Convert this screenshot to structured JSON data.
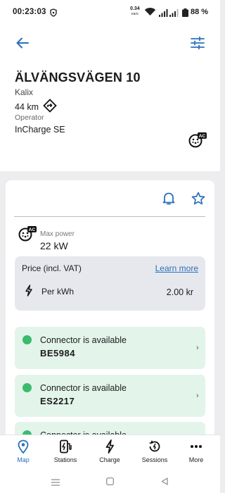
{
  "status_bar": {
    "time": "00:23:03",
    "net_speed": "0.34",
    "net_speed_unit": "KB/S",
    "battery_pct": "88 %"
  },
  "header": {
    "back_icon": "arrow-left-icon",
    "filter_icon": "sliders-icon"
  },
  "station": {
    "name": "ÄLVÄNGSVÄGEN 10",
    "city": "Kalix",
    "distance": "44 km",
    "operator_label": "Operator",
    "operator": "InCharge SE",
    "plug_badge": "AC"
  },
  "details": {
    "max_power_label": "Max power",
    "max_power_value": "22 kW",
    "plug_badge": "AC",
    "price": {
      "title": "Price (incl. VAT)",
      "learn_more": "Learn more",
      "per_kwh_label": "Per kWh",
      "per_kwh_value": "2.00 kr"
    }
  },
  "connectors": [
    {
      "status": "Connector is available",
      "id": "BE5984"
    },
    {
      "status": "Connector is available",
      "id": "ES2217"
    },
    {
      "status": "Connector is available",
      "id": ""
    }
  ],
  "colors": {
    "accent": "#2a70b9",
    "available": "#3cba6e",
    "connector_bg": "#e3f4ea",
    "price_bg": "#e6e8ee"
  },
  "bottom_nav": [
    {
      "label": "Map",
      "icon": "map-pin-icon",
      "active": true
    },
    {
      "label": "Stations",
      "icon": "charging-station-icon",
      "active": false
    },
    {
      "label": "Charge",
      "icon": "bolt-icon",
      "active": false
    },
    {
      "label": "Sessions",
      "icon": "sessions-icon",
      "active": false
    },
    {
      "label": "More",
      "icon": "more-dots-icon",
      "active": false
    }
  ]
}
